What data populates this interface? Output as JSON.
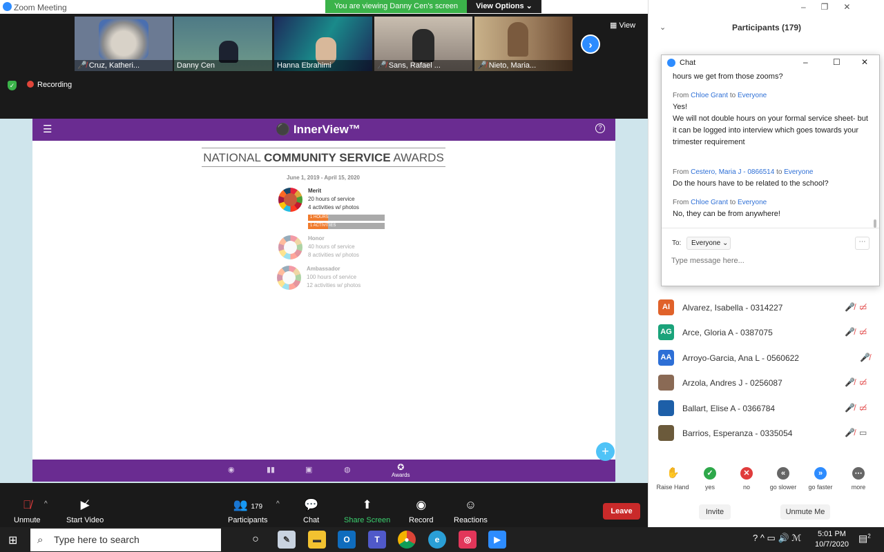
{
  "window": {
    "title": "Zoom Meeting"
  },
  "banner": {
    "viewing": "You are viewing Danny Cen's screen",
    "view_options": "View Options ⌄"
  },
  "thumbs": [
    {
      "name": "Cruz, Katheri...",
      "muted": true,
      "bg": "#6b7a93"
    },
    {
      "name": "Danny Cen",
      "muted": false,
      "bg": "#4e7a86"
    },
    {
      "name": "Hanna Ebrahimi",
      "muted": false,
      "bg": "#1c2a5a"
    },
    {
      "name": "Sans, Rafael ...",
      "muted": true,
      "bg": "#b8a99a"
    },
    {
      "name": "Nieto, Maria...",
      "muted": true,
      "bg": "#9a7b5b"
    }
  ],
  "view_label": "View",
  "recording": "Recording",
  "app": {
    "brand": "InnerView™",
    "awards_title_plain": "NATIONAL ",
    "awards_title_bold": "COMMUNITY SERVICE",
    "awards_title_end": " AWARDS",
    "date_range": "June 1, 2019 - April 15, 2020",
    "nav_awards": "Awards"
  },
  "awards": [
    {
      "name": "Merit",
      "line1": "20 hours of service",
      "line2": "4 activities w/ photos",
      "hours_bar": "1 HOURS",
      "activities_bar": "1 ACTIVITIES",
      "hours_progress": 0.05,
      "activities_progress": 0.25
    },
    {
      "name": "Honor",
      "line1": "40 hours of service",
      "line2": "8 activities w/ photos"
    },
    {
      "name": "Ambassador",
      "line1": "100 hours of service",
      "line2": "12 activities w/ photos"
    }
  ],
  "toolbar": {
    "unmute": "Unmute",
    "start_video": "Start Video",
    "participants": "Participants",
    "participants_count": "179",
    "chat": "Chat",
    "share_screen": "Share Screen",
    "record": "Record",
    "reactions": "Reactions",
    "leave": "Leave"
  },
  "panel": {
    "title": "Participants (179)"
  },
  "participants": [
    {
      "initials": "AI",
      "name": "Alvarez, Isabella - 0314227",
      "color": "#e0622a",
      "mic": "muted",
      "video": "off"
    },
    {
      "initials": "AG",
      "name": "Arce, Gloria A - 0387075",
      "color": "#1aa37a",
      "mic": "muted",
      "video": "off"
    },
    {
      "initials": "AA",
      "name": "Arroyo-Garcia, Ana L - 0560622",
      "color": "#2d6fd6",
      "mic": "muted",
      "video": "none"
    },
    {
      "initials": "",
      "name": "Arzola, Andres J - 0256087",
      "color": "#8a6a55",
      "mic": "muted",
      "video": "off"
    },
    {
      "initials": "",
      "name": "Ballart, Elise A - 0366784",
      "color": "#1d5fa8",
      "mic": "muted",
      "video": "off"
    },
    {
      "initials": "",
      "name": "Barrios, Esperanza - 0335054",
      "color": "#6b5a3b",
      "mic": "muted",
      "video": "on"
    }
  ],
  "reactions": [
    {
      "label": "Raise Hand",
      "glyph": "✋",
      "color": "#2d8cff"
    },
    {
      "label": "yes",
      "glyph": "✓",
      "color": "#2ea84a"
    },
    {
      "label": "no",
      "glyph": "✕",
      "color": "#e03c3c"
    },
    {
      "label": "go slower",
      "glyph": "«",
      "color": "#666"
    },
    {
      "label": "go faster",
      "glyph": "»",
      "color": "#2d8cff"
    },
    {
      "label": "more",
      "glyph": "⋯",
      "color": "#666"
    }
  ],
  "panel_buttons": {
    "invite": "Invite",
    "unmute_me": "Unmute Me"
  },
  "chat": {
    "title": "Chat",
    "partial": "hours we get from those zooms?",
    "messages": [
      {
        "from": "Chloe Grant",
        "to": "Everyone",
        "text": "Yes!\nWe will not double hours on your formal service sheet- but it can be logged into interview which goes towards your trimester requirement"
      },
      {
        "from": "Cestero, Maria J - 0866514",
        "to": "Everyone",
        "text": "Do the hours have to be related to the school?"
      },
      {
        "from": "Chloe Grant",
        "to": "Everyone",
        "text": "No, they can be from anywhere!"
      }
    ],
    "from_word": "From",
    "to_word": "to",
    "to_label": "To:",
    "to_select": "Everyone ⌄",
    "placeholder": "Type message here..."
  },
  "taskbar": {
    "search": "Type here to search",
    "time": "5:01 PM",
    "date": "10/7/2020",
    "notif_count": "2"
  }
}
